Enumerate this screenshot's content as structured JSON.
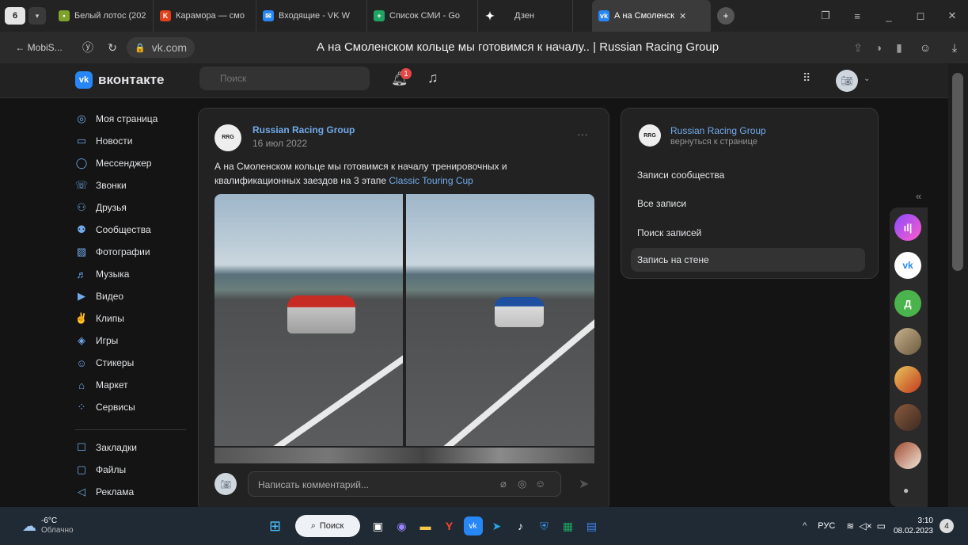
{
  "browser": {
    "tab_count": "6",
    "tabs": [
      {
        "label": "Белый лотос (202",
        "icon": "lotus-tab-icon"
      },
      {
        "label": "Карамора — смо",
        "icon": "kinopoisk-tab-icon"
      },
      {
        "label": "Входящие - VK W",
        "icon": "mail-tab-icon"
      },
      {
        "label": "Список СМИ - Go",
        "icon": "sheets-tab-icon"
      },
      {
        "label": "Дзен",
        "icon": "dzen-tab-icon"
      },
      {
        "label": "А на Смоленск",
        "icon": "vk-tab-icon"
      }
    ],
    "back_label": "← MobiS...",
    "url": "vk.com",
    "page_title": "А на Смоленском кольце мы готовимся к началу.. | Russian Racing Group"
  },
  "vk": {
    "logo_text": "вконтакте",
    "search_placeholder": "Поиск",
    "notification_count": "1",
    "sidebar": [
      {
        "label": "Моя страница",
        "icon": "user-icon"
      },
      {
        "label": "Новости",
        "icon": "news-icon"
      },
      {
        "label": "Мессенджер",
        "icon": "message-icon"
      },
      {
        "label": "Звонки",
        "icon": "phone-icon"
      },
      {
        "label": "Друзья",
        "icon": "friends-icon"
      },
      {
        "label": "Сообщества",
        "icon": "communities-icon"
      },
      {
        "label": "Фотографии",
        "icon": "photo-icon"
      },
      {
        "label": "Музыка",
        "icon": "music-icon"
      },
      {
        "label": "Видео",
        "icon": "video-icon"
      },
      {
        "label": "Клипы",
        "icon": "clips-icon"
      },
      {
        "label": "Игры",
        "icon": "games-icon"
      },
      {
        "label": "Стикеры",
        "icon": "stickers-icon"
      },
      {
        "label": "Маркет",
        "icon": "market-icon"
      },
      {
        "label": "Сервисы",
        "icon": "services-icon"
      }
    ],
    "sidebar_extra": [
      {
        "label": "Закладки",
        "icon": "bookmark-icon"
      },
      {
        "label": "Файлы",
        "icon": "files-icon"
      },
      {
        "label": "Реклама",
        "icon": "ads-icon"
      }
    ],
    "post": {
      "author": "Russian Racing Group",
      "date": "16 июл 2022",
      "text": "А на Смоленском кольце мы готовимся к началу тренировочных и квалификационных заездов на 3 этапе ",
      "link": "Classic Touring Cup",
      "comment_placeholder": "Написать комментарий..."
    },
    "right_menu": {
      "group_name": "Russian Racing Group",
      "back_label": "вернуться к странице",
      "items": [
        "Записи сообщества",
        "Все записи",
        "Поиск записей",
        "Запись на стене"
      ]
    },
    "rail": {
      "letter": "Д"
    }
  },
  "taskbar": {
    "temp": "-6°C",
    "weather": "Облачно",
    "search_label": "Поиск",
    "lang": "РУС",
    "time": "3:10",
    "date": "08.02.2023"
  }
}
